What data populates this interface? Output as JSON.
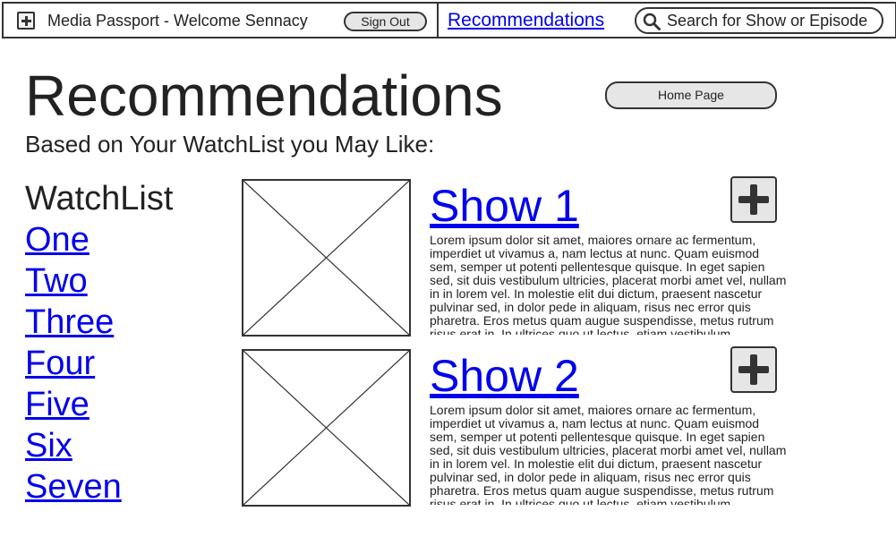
{
  "header": {
    "app_title": "Media Passport - Welcome Sennacy",
    "sign_out_label": "Sign Out",
    "nav_link_label": "Recommendations",
    "search_placeholder": "Search for Show or Episode"
  },
  "page": {
    "title": "Recommendations",
    "home_button_label": "Home Page",
    "subtitle": "Based on Your WatchList you May Like:"
  },
  "watchlist": {
    "title": "WatchList",
    "items": [
      "One",
      "Two",
      "Three",
      "Four",
      "Five",
      "Six",
      "Seven"
    ]
  },
  "shows": [
    {
      "title": "Show 1",
      "description": "Lorem ipsum dolor sit amet, maiores ornare ac fermentum, imperdiet ut vivamus a, nam lectus at nunc. Quam euismod sem, semper ut potenti pellentesque quisque. In eget sapien sed, sit duis vestibulum ultricies, placerat morbi amet vel, nullam in in lorem vel. In molestie elit dui dictum, praesent nascetur pulvinar sed, in dolor pede in aliquam, risus nec error quis pharetra. Eros metus quam augue suspendisse, metus rutrum risus erat in.  In ultrices quo ut lectus, etiam vestibulum"
    },
    {
      "title": "Show 2",
      "description": "Lorem ipsum dolor sit amet, maiores ornare ac fermentum, imperdiet ut vivamus a, nam lectus at nunc. Quam euismod sem, semper ut potenti pellentesque quisque. In eget sapien sed, sit duis vestibulum ultricies, placerat morbi amet vel, nullam in in lorem vel. In molestie elit dui dictum, praesent nascetur pulvinar sed, in dolor pede in aliquam, risus nec error quis pharetra. Eros metus quam augue suspendisse, metus rutrum risus erat in.  In ultrices quo ut lectus, etiam vestibulum"
    }
  ],
  "icons": {
    "app": "plus-box-icon",
    "search": "search-icon",
    "add": "plus-icon",
    "thumbnail": "image-placeholder-icon"
  },
  "colors": {
    "link": "#0000ee",
    "border": "#333333",
    "button_fill": "#e6e6e6"
  }
}
